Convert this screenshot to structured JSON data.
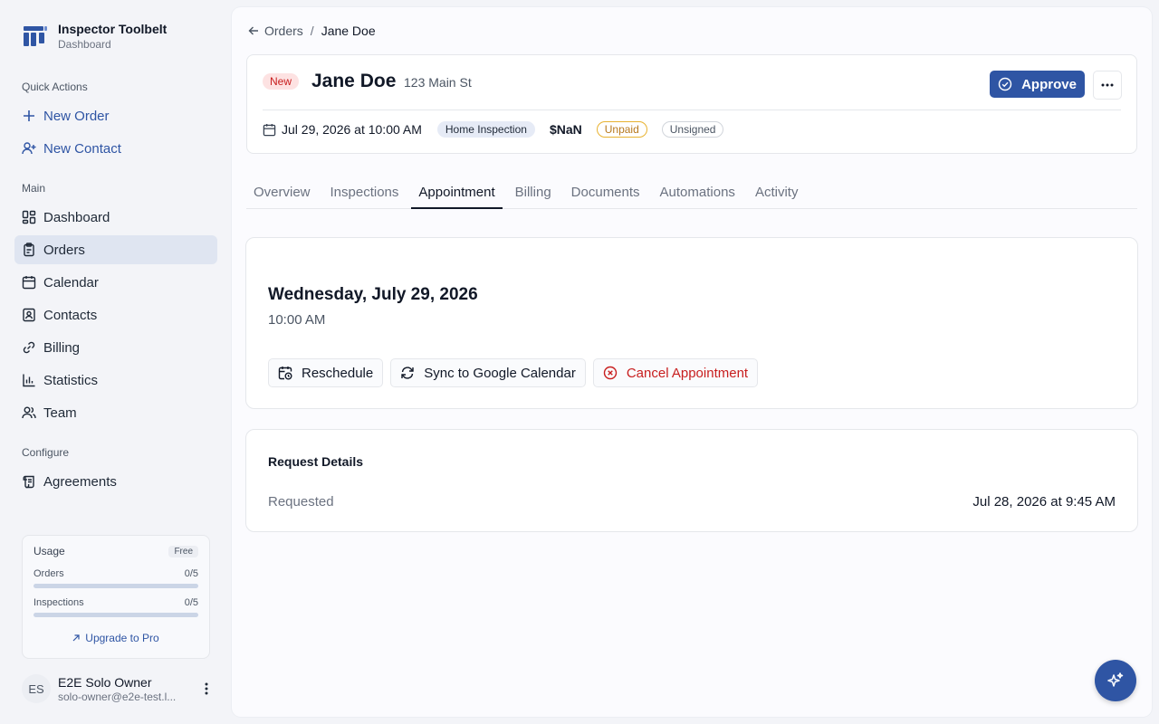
{
  "brand": {
    "title": "Inspector Toolbelt",
    "subtitle": "Dashboard"
  },
  "sidebar": {
    "quick_actions_label": "Quick Actions",
    "quick_actions": [
      {
        "label": "New Order",
        "icon": "plus-icon"
      },
      {
        "label": "New Contact",
        "icon": "user-plus-icon"
      }
    ],
    "main_label": "Main",
    "main_items": [
      {
        "label": "Dashboard",
        "icon": "dashboard-icon"
      },
      {
        "label": "Orders",
        "icon": "clipboard-icon",
        "active": true
      },
      {
        "label": "Calendar",
        "icon": "calendar-icon"
      },
      {
        "label": "Contacts",
        "icon": "contact-card-icon"
      },
      {
        "label": "Billing",
        "icon": "link-icon"
      },
      {
        "label": "Statistics",
        "icon": "bar-chart-icon"
      },
      {
        "label": "Team",
        "icon": "users-icon"
      }
    ],
    "configure_label": "Configure",
    "configure_items": [
      {
        "label": "Agreements",
        "icon": "scroll-icon"
      }
    ]
  },
  "usage": {
    "title": "Usage",
    "plan": "Free",
    "orders_label": "Orders",
    "orders_value": "0/5",
    "orders_fraction": 0,
    "inspections_label": "Inspections",
    "inspections_value": "0/5",
    "inspections_fraction": 0,
    "upgrade_label": "Upgrade to Pro"
  },
  "user": {
    "initials": "ES",
    "name": "E2E Solo Owner",
    "email": "solo-owner@e2e-test.l..."
  },
  "breadcrumb": {
    "parent": "Orders",
    "separator": "/",
    "current": "Jane Doe"
  },
  "order": {
    "status": "New",
    "name": "Jane Doe",
    "address": "123 Main St",
    "approve_label": "Approve",
    "datetime": "Jul 29, 2026 at 10:00 AM",
    "type": "Home Inspection",
    "price": "$NaN",
    "payment_status": "Unpaid",
    "agreement_status": "Unsigned"
  },
  "tabs": [
    {
      "label": "Overview"
    },
    {
      "label": "Inspections"
    },
    {
      "label": "Appointment",
      "active": true
    },
    {
      "label": "Billing"
    },
    {
      "label": "Documents"
    },
    {
      "label": "Automations"
    },
    {
      "label": "Activity"
    }
  ],
  "appointment": {
    "date": "Wednesday, July 29, 2026",
    "time": "10:00 AM",
    "reschedule_label": "Reschedule",
    "sync_label": "Sync to Google Calendar",
    "cancel_label": "Cancel Appointment"
  },
  "request": {
    "title": "Request Details",
    "requested_label": "Requested",
    "requested_value": "Jul 28, 2026 at 9:45 AM"
  },
  "colors": {
    "accent": "#2f55a4",
    "danger": "#c81e1e",
    "warning": "#b7791f"
  }
}
